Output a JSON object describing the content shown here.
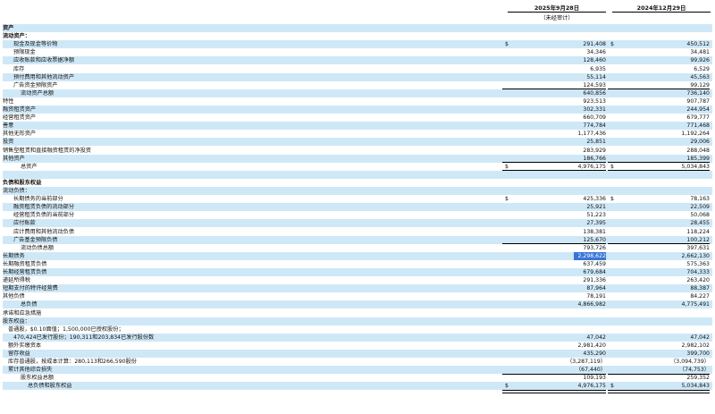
{
  "header": {
    "col1": "2025年9月28日",
    "col2": "2024年12月29日",
    "unaudited": "（未经审计）"
  },
  "rows": [
    {
      "label": "资产",
      "sec": true
    },
    {
      "label": "流动资产：",
      "sec": true
    },
    {
      "label": "现金及现金等价物",
      "indent": 2,
      "cur1": "$",
      "v1": "291,408",
      "cur2": "$",
      "v2": "450,512"
    },
    {
      "label": "预限现金",
      "indent": 2,
      "v1": "34,346",
      "v2": "34,481"
    },
    {
      "label": "应收账款和应收票据净额",
      "indent": 2,
      "v1": "128,460",
      "v2": "99,926"
    },
    {
      "label": "库存",
      "indent": 2,
      "v1": "6,935",
      "v2": "6,529"
    },
    {
      "label": "预付费用和其他流动资产",
      "indent": 2,
      "v1": "55,114",
      "v2": "45,563"
    },
    {
      "label": "广告资金预限资产",
      "indent": 2,
      "v1": "124,593",
      "v2": "99,129",
      "line": "single"
    },
    {
      "label": "流动资产总额",
      "indent": 3,
      "v1": "640,856",
      "v2": "736,140"
    },
    {
      "label": "特性",
      "indent": 0,
      "v1": "923,513",
      "v2": "907,787"
    },
    {
      "label": "融资租赁资产",
      "indent": 0,
      "v1": "302,331",
      "v2": "244,954"
    },
    {
      "label": "经营租赁资产",
      "indent": 0,
      "v1": "660,709",
      "v2": "679,777"
    },
    {
      "label": "善意",
      "indent": 0,
      "v1": "774,784",
      "v2": "771,468"
    },
    {
      "label": "其他无形资产",
      "indent": 0,
      "v1": "1,177,436",
      "v2": "1,192,264"
    },
    {
      "label": "投资",
      "indent": 0,
      "v1": "25,851",
      "v2": "29,006"
    },
    {
      "label": "销售型租赁和直接融资租赁的净投资",
      "indent": 0,
      "v1": "283,929",
      "v2": "288,048"
    },
    {
      "label": "其他资产",
      "indent": 0,
      "v1": "186,766",
      "v2": "185,399",
      "line": "single"
    },
    {
      "label": "总资产",
      "indent": 3,
      "cur1": "$",
      "v1": "4,976,175",
      "cur2": "$",
      "v2": "5,034,843",
      "line": "double"
    },
    {
      "label": "",
      "blank": true
    },
    {
      "label": "负债和股东权益",
      "sec": true
    },
    {
      "label": "流动负债：",
      "sec": false
    },
    {
      "label": "长期债务的当前部分",
      "indent": 2,
      "cur1": "$",
      "v1": "425,336",
      "cur2": "$",
      "v2": "78,163"
    },
    {
      "label": "融资租赁负债的流动部分",
      "indent": 2,
      "v1": "25,921",
      "v2": "22,509"
    },
    {
      "label": "经营租赁负债的当前部分",
      "indent": 2,
      "v1": "51,223",
      "v2": "50,068"
    },
    {
      "label": "应付账款",
      "indent": 2,
      "v1": "27,395",
      "v2": "28,455"
    },
    {
      "label": "应计费用和其他流动负债",
      "indent": 2,
      "v1": "138,381",
      "v2": "118,224"
    },
    {
      "label": "广告基金预限负债",
      "indent": 2,
      "v1": "125,670",
      "v2": "100,212",
      "line": "single"
    },
    {
      "label": "流动负债总额",
      "indent": 3,
      "v1": "793,726",
      "v2": "397,631"
    },
    {
      "label": "长期债务",
      "indent": 0,
      "v1": "2,298,622",
      "v2": "2,662,130",
      "hl": true
    },
    {
      "label": "长期融资租赁负债",
      "indent": 0,
      "v1": "637,459",
      "v2": "575,363"
    },
    {
      "label": "长期经营租赁负债",
      "indent": 0,
      "v1": "679,684",
      "v2": "704,333"
    },
    {
      "label": "递延所得税",
      "indent": 0,
      "v1": "291,336",
      "v2": "263,420"
    },
    {
      "label": "短期支付的特许经营费",
      "indent": 0,
      "v1": "87,964",
      "v2": "88,387"
    },
    {
      "label": "其他负债",
      "indent": 0,
      "v1": "78,191",
      "v2": "84,227",
      "line": "single"
    },
    {
      "label": "总负债",
      "indent": 3,
      "v1": "4,866,982",
      "v2": "4,775,491"
    },
    {
      "label": "承诺和应急措施",
      "indent": 0
    },
    {
      "label": "股东权益：",
      "indent": 0
    },
    {
      "label": "普通股，$0.10面值；1,500,000已授权股份；",
      "indent": 1
    },
    {
      "label": "470,424已发行股份；190,311和203,834已发行股份数",
      "indent": 2,
      "v1": "47,042",
      "v2": "47,042"
    },
    {
      "label": "额外实缴资本",
      "indent": 1,
      "v1": "2,981,420",
      "v2": "2,982,102"
    },
    {
      "label": "留存收益",
      "indent": 1,
      "v1": "435,290",
      "v2": "399,700"
    },
    {
      "label": "库存普通股，按成本计算：280,113和266,590股份",
      "indent": 1,
      "v1": "（3,287,119）",
      "v2": "（3,094,739）"
    },
    {
      "label": "累计其他综合损失",
      "indent": 1,
      "v1": "（67,440）",
      "v2": "（74,753）",
      "line": "single"
    },
    {
      "label": "股东权益总额",
      "indent": 3,
      "v1": "109,193",
      "v2": "259,352",
      "line": "single"
    },
    {
      "label": "总负债和股东权益",
      "indent": 4,
      "cur1": "$",
      "v1": "4,976,175",
      "cur2": "$",
      "v2": "5,034,843",
      "line": "double"
    }
  ]
}
